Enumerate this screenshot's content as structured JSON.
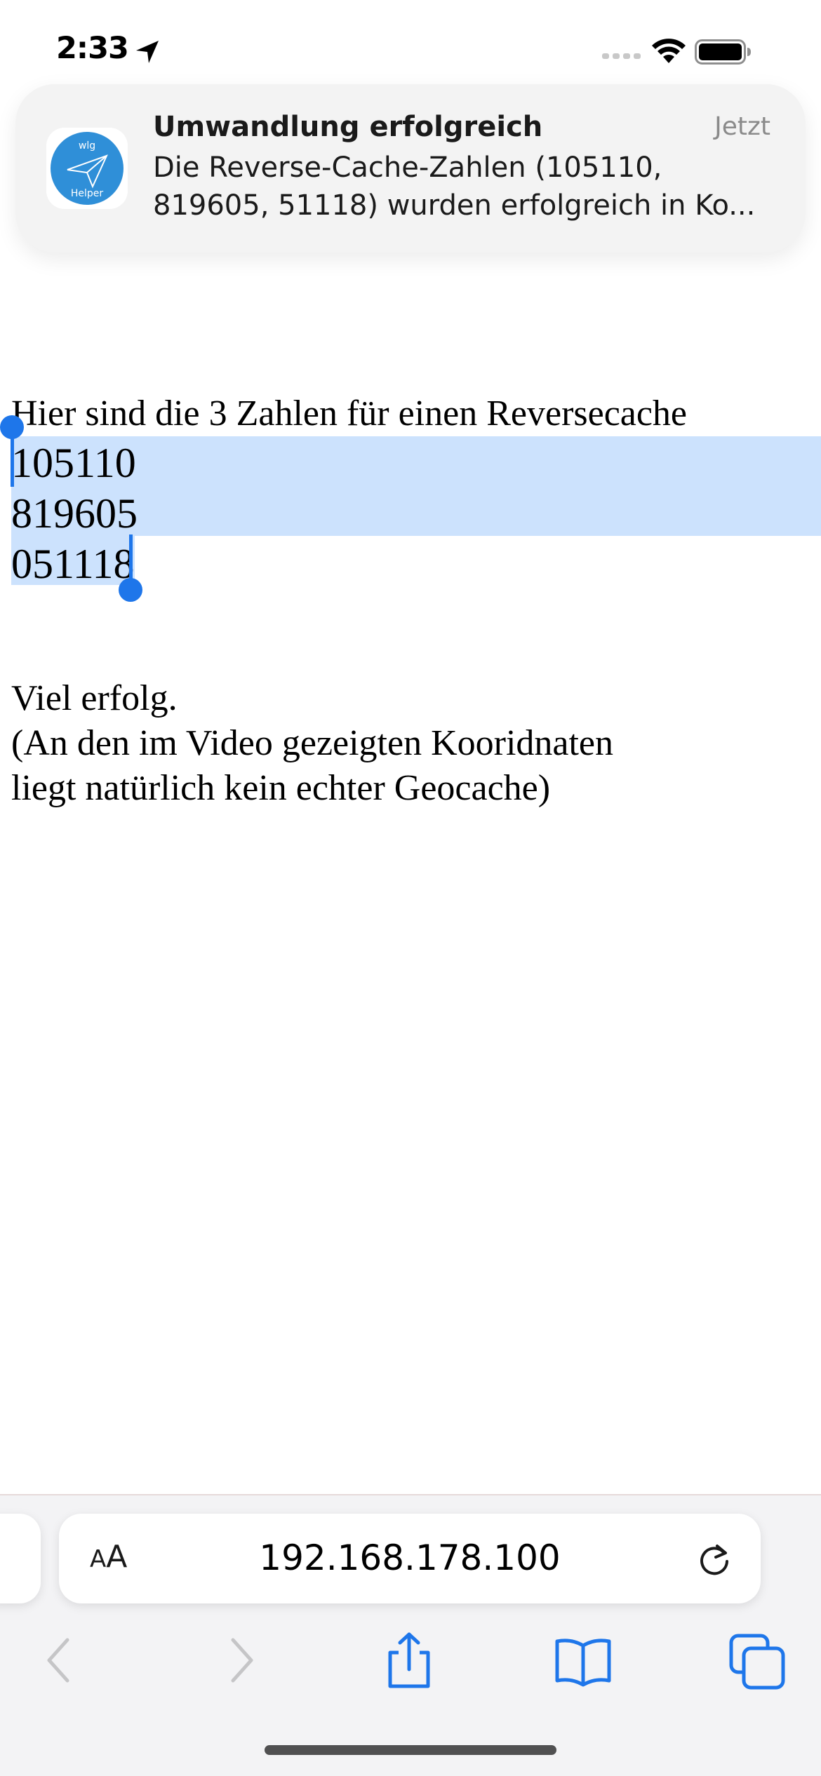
{
  "status_bar": {
    "time": "2:33",
    "location_icon": "location-arrow-icon",
    "signal_icon": "cellular-signal-icon",
    "wifi_icon": "wifi-icon",
    "battery_icon": "battery-icon"
  },
  "notification": {
    "app_icon": "wlg-helper-app-icon",
    "app_icon_text_top": "wlg",
    "app_icon_text_bottom": "Helper",
    "title": "Umwandlung erfolgreich",
    "time": "Jetzt",
    "body_line1": "Die Reverse-Cache-Zahlen (105110,",
    "body_line2": "819605, 51118) wurden erfolgreich in Ko..."
  },
  "content": {
    "intro": "Hier sind die 3 Zahlen für einen Reversecache",
    "numbers": [
      "105110",
      "819605",
      "051118"
    ],
    "outro_line1": "Viel erfolg.",
    "outro_line2": "(An den im Video gezeigten Kooridnaten",
    "outro_line3": "liegt natürlich kein echter Geocache)"
  },
  "address_bar": {
    "aa_small": "A",
    "aa_big": "A",
    "url": "192.168.178.100",
    "reload_icon": "reload-icon"
  },
  "toolbar": {
    "back_icon": "chevron-left-icon",
    "forward_icon": "chevron-right-icon",
    "share_icon": "share-icon",
    "bookmarks_icon": "book-icon",
    "tabs_icon": "tabs-icon"
  },
  "colors": {
    "accent": "#1e76ea",
    "selection": "#cce2fd",
    "app_icon_blue": "#2f8fd8"
  }
}
